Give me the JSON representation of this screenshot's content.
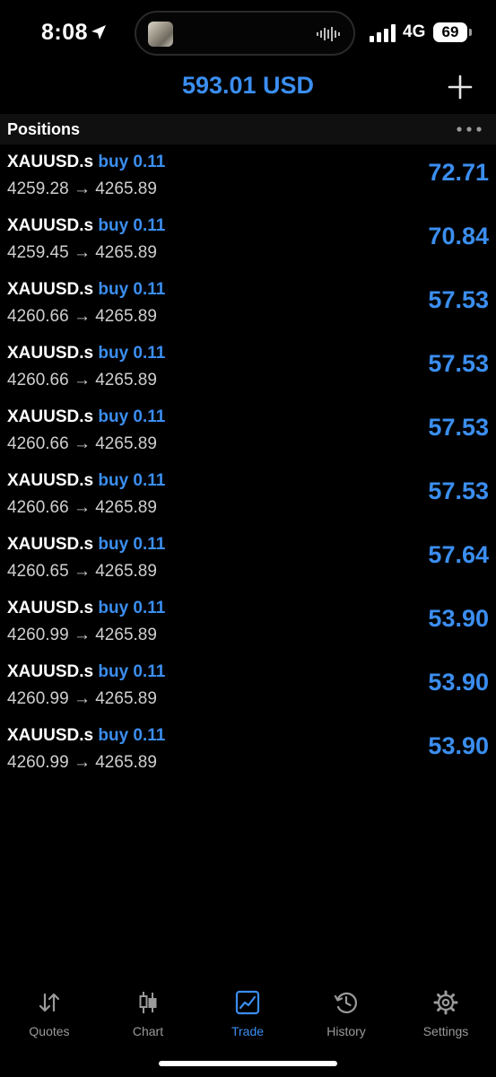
{
  "status_bar": {
    "time": "8:08",
    "network": "4G",
    "battery": "69"
  },
  "header": {
    "balance": "593.01 USD",
    "add_icon": "plus-icon"
  },
  "positions_section": {
    "title": "Positions",
    "more_icon": "ellipsis-icon"
  },
  "positions": [
    {
      "symbol": "XAUUSD.s",
      "side": "buy 0.11",
      "prices": "4259.28 → 4265.89",
      "profit": "72.71"
    },
    {
      "symbol": "XAUUSD.s",
      "side": "buy 0.11",
      "prices": "4259.45 → 4265.89",
      "profit": "70.84"
    },
    {
      "symbol": "XAUUSD.s",
      "side": "buy 0.11",
      "prices": "4260.66 → 4265.89",
      "profit": "57.53"
    },
    {
      "symbol": "XAUUSD.s",
      "side": "buy 0.11",
      "prices": "4260.66 → 4265.89",
      "profit": "57.53"
    },
    {
      "symbol": "XAUUSD.s",
      "side": "buy 0.11",
      "prices": "4260.66 → 4265.89",
      "profit": "57.53"
    },
    {
      "symbol": "XAUUSD.s",
      "side": "buy 0.11",
      "prices": "4260.66 → 4265.89",
      "profit": "57.53"
    },
    {
      "symbol": "XAUUSD.s",
      "side": "buy 0.11",
      "prices": "4260.65 → 4265.89",
      "profit": "57.64"
    },
    {
      "symbol": "XAUUSD.s",
      "side": "buy 0.11",
      "prices": "4260.99 → 4265.89",
      "profit": "53.90"
    },
    {
      "symbol": "XAUUSD.s",
      "side": "buy 0.11",
      "prices": "4260.99 → 4265.89",
      "profit": "53.90"
    },
    {
      "symbol": "XAUUSD.s",
      "side": "buy 0.11",
      "prices": "4260.99 → 4265.89",
      "profit": "53.90"
    }
  ],
  "tabs": [
    {
      "label": "Quotes",
      "icon": "quotes-arrows-icon",
      "active": false
    },
    {
      "label": "Chart",
      "icon": "candlestick-icon",
      "active": false
    },
    {
      "label": "Trade",
      "icon": "trade-chart-icon",
      "active": true
    },
    {
      "label": "History",
      "icon": "history-clock-icon",
      "active": false
    },
    {
      "label": "Settings",
      "icon": "gear-icon",
      "active": false
    }
  ],
  "colors": {
    "accent": "#3b8ef0",
    "background": "#000000",
    "header_band": "#101010",
    "secondary_text": "#cfcfcf",
    "inactive_tab": "#9a9a9a"
  }
}
